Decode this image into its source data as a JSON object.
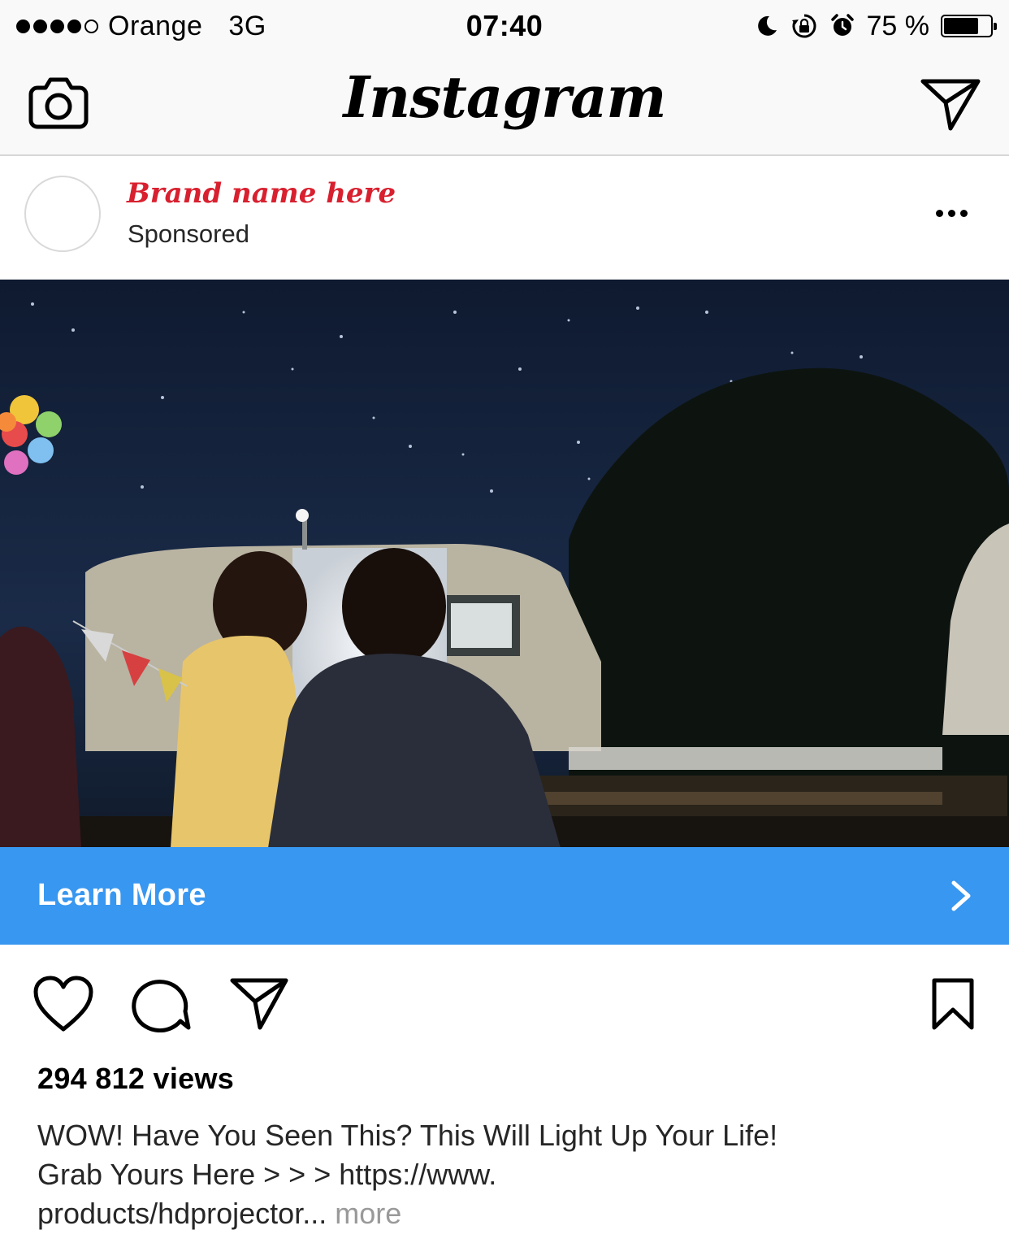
{
  "status_bar": {
    "carrier": "Orange",
    "network": "3G",
    "time": "07:40",
    "battery_percent": "75 %",
    "battery_level": 0.75,
    "signal_bars_filled": 4,
    "signal_bars_total": 5
  },
  "nav": {
    "logo_text": "Instagram",
    "left_icon": "camera-icon",
    "right_icon": "direct-message-icon"
  },
  "post": {
    "brand_name": "Brand name here",
    "sponsored_label": "Sponsored",
    "options_icon": "more-options-icon",
    "cta_label": "Learn More",
    "cta_color": "#3897f0",
    "views": "294 812 views",
    "caption_lines": [
      "WOW! Have You Seen This? This Will Light Up Your Life!",
      "Grab Yours Here > > > https://www.",
      "products/hdprojector..."
    ],
    "more_label": "more",
    "brand_color": "#d8202f"
  },
  "actions": {
    "like_icon": "heart-icon",
    "comment_icon": "comment-icon",
    "share_icon": "share-icon",
    "save_icon": "bookmark-icon"
  }
}
